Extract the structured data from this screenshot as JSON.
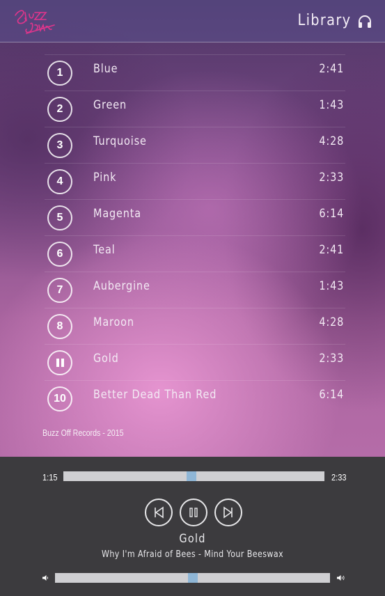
{
  "header": {
    "title": "Library",
    "logo_text": "Buzz Jams",
    "headphones_icon": "headphones-icon"
  },
  "tracks": [
    {
      "num": "1",
      "name": "Blue",
      "duration": "2:41"
    },
    {
      "num": "2",
      "name": "Green",
      "duration": "1:43"
    },
    {
      "num": "3",
      "name": "Turquoise",
      "duration": "4:28"
    },
    {
      "num": "4",
      "name": "Pink",
      "duration": "2:33"
    },
    {
      "num": "5",
      "name": "Magenta",
      "duration": "6:14"
    },
    {
      "num": "6",
      "name": "Teal",
      "duration": "2:41"
    },
    {
      "num": "7",
      "name": "Aubergine",
      "duration": "1:43"
    },
    {
      "num": "8",
      "name": "Maroon",
      "duration": "4:28"
    },
    {
      "num": "",
      "name": "Gold",
      "duration": "2:33",
      "playing_icon": "pause-icon"
    },
    {
      "num": "10",
      "name": "Better Dead Than Red",
      "duration": "6:14"
    }
  ],
  "credit": "Buzz Off Records - 2015",
  "player": {
    "current_time": "1:15",
    "total_time": "2:33",
    "progress": 0.49,
    "volume": 0.5,
    "now_playing_title": "Gold",
    "now_playing_subtitle": "Why I'm Afraid of Bees - Mind Your Beeswax",
    "controls": [
      "previous-icon",
      "pause-icon",
      "next-icon"
    ],
    "accent_color": "#8fb6d6"
  },
  "colors": {
    "player_bg": "#3c3b3e",
    "logo_pink": "#e0358c"
  }
}
